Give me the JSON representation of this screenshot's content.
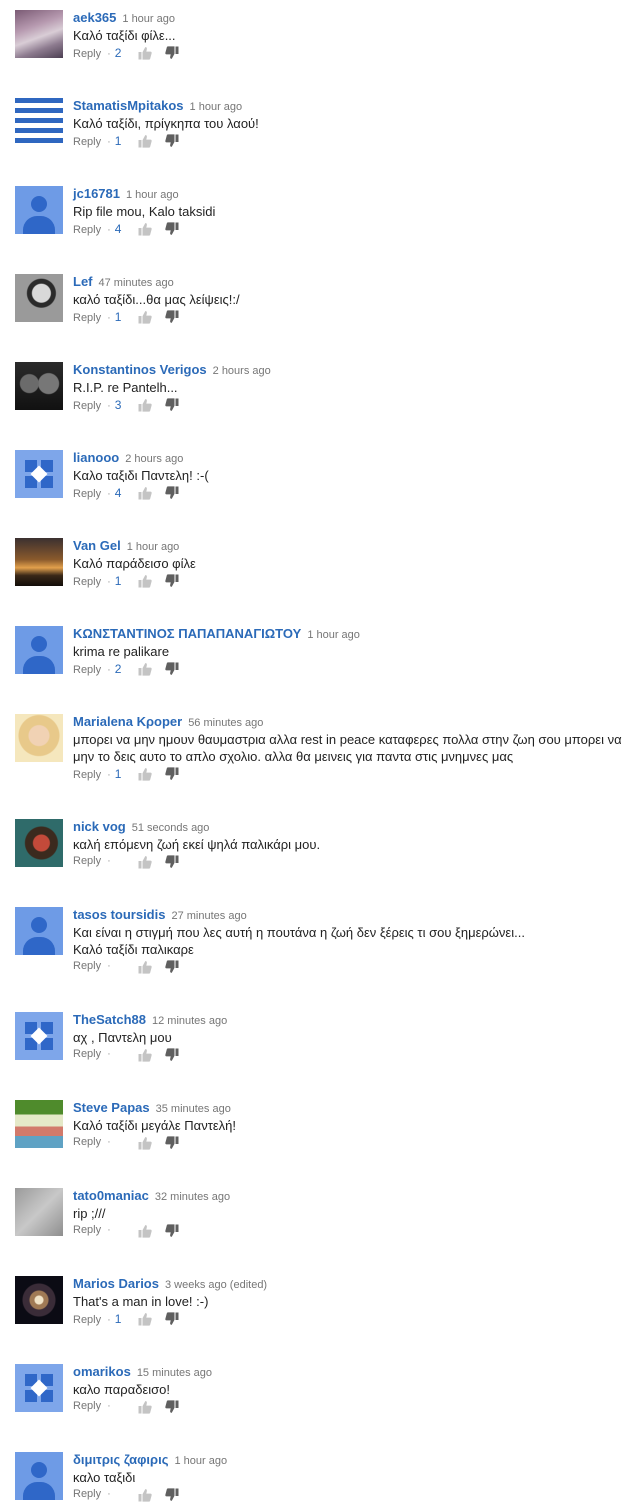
{
  "reply_label": "Reply",
  "comments": [
    {
      "author": "aek365",
      "time": "1 hour ago",
      "text": "Καλό ταξίδι φίλε...",
      "likes": "2",
      "avatar": "photo-building"
    },
    {
      "author": "StamatisΜpitakos",
      "time": "1 hour ago",
      "text": "Καλό ταξίδι, πρίγκηπα του λαού!",
      "likes": "1",
      "avatar": "photo-flag-man"
    },
    {
      "author": "jc16781",
      "time": "1 hour ago",
      "text": "Rip file mou, Kalo taksidi",
      "likes": "4",
      "avatar": "default-person"
    },
    {
      "author": "Lef",
      "time": "47 minutes ago",
      "text": "καλό ταξίδι...θα μας λείψεις!:/",
      "likes": "1",
      "avatar": "photo-bw-man"
    },
    {
      "author": "Konstantinos Verigos",
      "time": "2 hours ago",
      "text": "R.I.P. re Pantelh...",
      "likes": "3",
      "avatar": "photo-two-men"
    },
    {
      "author": "lianooo",
      "time": "2 hours ago",
      "text": "Καλο ταξιδι Παντελη! :-(",
      "likes": "4",
      "avatar": "default-pattern"
    },
    {
      "author": "Van Gel",
      "time": "1 hour ago",
      "text": "Καλό παράδεισο φίλε",
      "likes": "1",
      "avatar": "photo-sunset"
    },
    {
      "author": "ΚΩΝΣΤΑΝΤΙΝΟΣ ΠΑΠΑΠΑΝΑΓΙΩΤΟΥ",
      "time": "1 hour ago",
      "text": "krima re palikare",
      "likes": "2",
      "avatar": "default-person"
    },
    {
      "author": "Marialena Κρoper",
      "time": "56 minutes ago",
      "text": "μπορει να μην ημουν θαυμαστρια αλλα rest in peace καταφερες πολλα στην ζωη σου μπορει να μην το δεις αυτο το απλο σχολιο. αλλα θα μεινεις για παντα στις μνημνες μας",
      "likes": "1",
      "avatar": "photo-blonde"
    },
    {
      "author": "nick vog",
      "time": "51 seconds ago",
      "text": "καλή επόμενη ζωή εκεί ψηλά παλικάρι μου.",
      "likes": "",
      "avatar": "photo-face-paint"
    },
    {
      "author": "tasos toursidis",
      "time": "27 minutes ago",
      "text": "Και είναι η στιγμή που λες αυτή η πουτάνα η ζωή δεν ξέρεις τι σου ξημερώνει...\nΚαλό ταξίδι παλικαρε",
      "likes": "",
      "avatar": "default-person"
    },
    {
      "author": "TheSatch88",
      "time": "12 minutes ago",
      "text": "αχ , Παντελη μου",
      "likes": "",
      "avatar": "default-pattern"
    },
    {
      "author": "Steve Papas",
      "time": "35 minutes ago",
      "text": "Καλό ταξίδι μεγάλε Παντελή!",
      "likes": "",
      "avatar": "photo-herbalife"
    },
    {
      "author": "tato0maniac",
      "time": "32 minutes ago",
      "text": "rip ;///",
      "likes": "",
      "avatar": "photo-handwriting"
    },
    {
      "author": "Marios Darios",
      "time": "3 weeks ago (edited)",
      "text": "That's a man in love! :-)",
      "likes": "1",
      "avatar": "photo-galaxy"
    },
    {
      "author": "omarikos",
      "time": "15 minutes ago",
      "text": "καλο παραδεισο!",
      "likes": "",
      "avatar": "default-pattern"
    },
    {
      "author": "διμιτρις ζαφιρις",
      "time": "1 hour ago",
      "text": "καλο ταξιδι",
      "likes": "",
      "avatar": "default-person"
    }
  ]
}
